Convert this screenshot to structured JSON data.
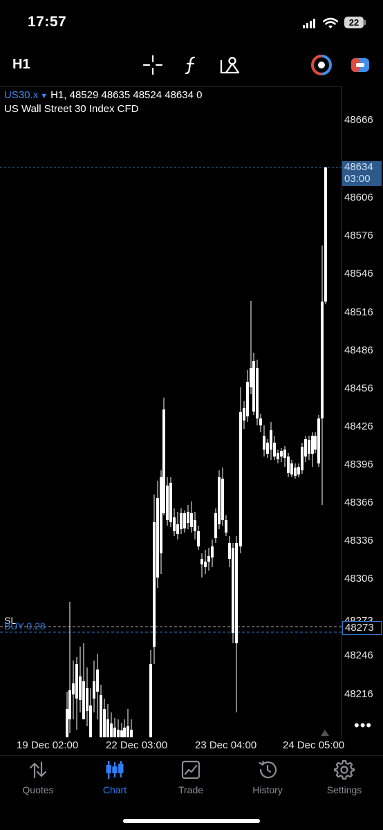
{
  "status_bar": {
    "time": "17:57",
    "battery": "22"
  },
  "toolbar": {
    "timeframe": "H1",
    "tools": [
      "crosshair-icon",
      "indicators-icon",
      "objects-icon"
    ],
    "right_tools": [
      "trade-clock-icon",
      "chart-toggle-icon"
    ]
  },
  "chart": {
    "symbol": "US30.x",
    "header_values": "H1, 48529 48635 48524 48634 0",
    "description": "US Wall Street 30 Index CFD",
    "price_tag": {
      "price": "48634",
      "countdown": "03:00"
    },
    "y_ticks": [
      "48666",
      "48606",
      "48576",
      "48546",
      "48516",
      "48486",
      "48456",
      "48426",
      "48396",
      "48366",
      "48336",
      "48306",
      "48273",
      "48246",
      "48216"
    ],
    "x_ticks": [
      "19 Dec 02:00",
      "22 Dec 03:00",
      "23 Dec 04:00",
      "24 Dec 05:00"
    ],
    "sl_label": "SL",
    "buy_label": "BUY 0.28",
    "sl_price": "48273",
    "more": "•••"
  },
  "colors": {
    "accent": "#2f7df6",
    "price_tag_bg": "#2d5a8a",
    "candle": "#ffffff",
    "background": "#000000"
  },
  "nav": [
    {
      "label": "Quotes",
      "icon": "quotes-icon"
    },
    {
      "label": "Chart",
      "icon": "chart-icon",
      "active": true
    },
    {
      "label": "Trade",
      "icon": "trade-icon"
    },
    {
      "label": "History",
      "icon": "history-icon"
    },
    {
      "label": "Settings",
      "icon": "settings-icon"
    }
  ]
}
